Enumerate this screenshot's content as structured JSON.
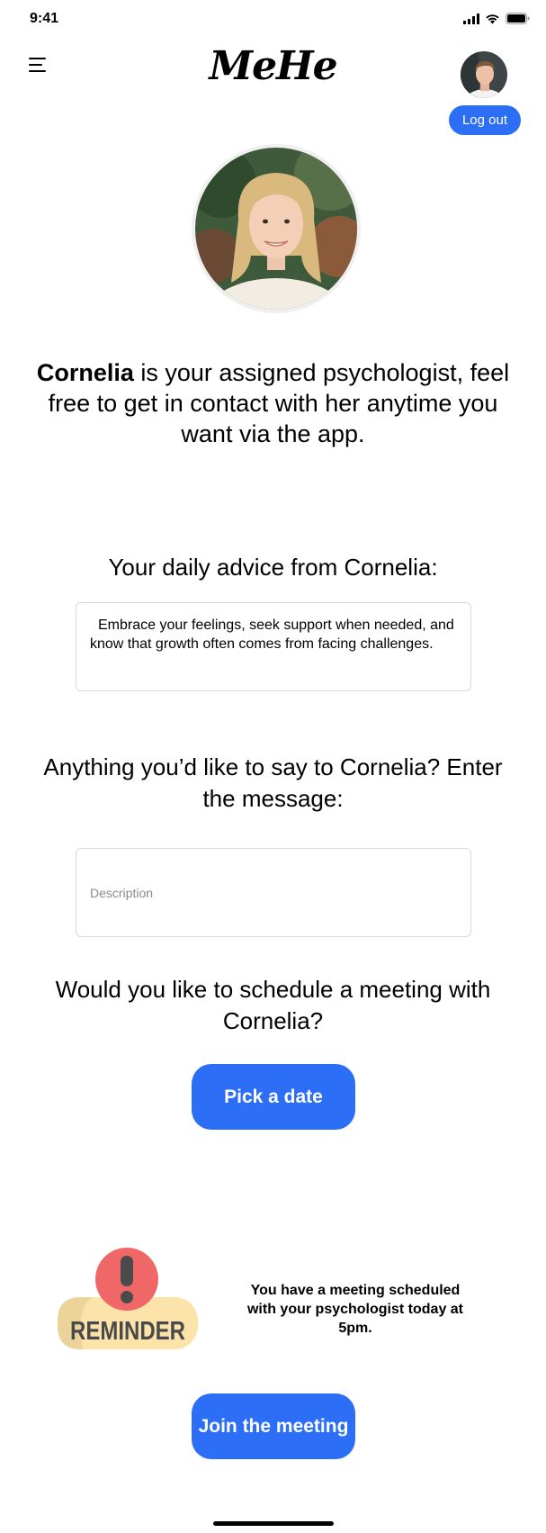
{
  "status_bar": {
    "time": "9:41",
    "icons": [
      "signal-icon",
      "wifi-icon",
      "battery-icon"
    ]
  },
  "header": {
    "logo": "MeHe",
    "logout_label": "Log out",
    "menu_icon": "hamburger-menu-icon"
  },
  "psychologist": {
    "name": "Cornelia",
    "intro_rest": " is your assigned psychologist, feel free to get in contact with her anytime you want via the app."
  },
  "advice": {
    "heading": "Your daily advice from Cornelia:",
    "text": "Embrace your feelings, seek support when needed, and know that growth often comes from facing challenges."
  },
  "message": {
    "heading": "Anything you’d like to say to Cornelia? Enter the message:",
    "placeholder": "Description",
    "value": ""
  },
  "schedule": {
    "heading": "Would you like to schedule a meeting with Cornelia?",
    "button_label": "Pick a date"
  },
  "reminder": {
    "badge_text": "REMINDER",
    "text": "You have a meeting scheduled with your psychologist today at 5pm.",
    "button_label": "Join the meeting"
  },
  "colors": {
    "accent": "#2d6ef7",
    "reminder_red": "#f06767",
    "reminder_badge": "#fbe3a9"
  }
}
